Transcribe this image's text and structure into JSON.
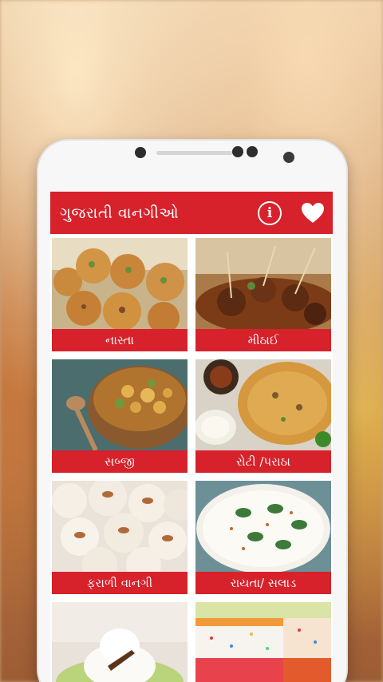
{
  "app": {
    "title": "ગુજરાતી વાનગીઓ",
    "info_icon": "info-icon",
    "favorite_icon": "heart-icon",
    "accent_color": "#d7212b"
  },
  "categories": [
    {
      "label": "નાસ્તા",
      "image": "snack-cookies-photo"
    },
    {
      "label": "મીઠાઈ",
      "image": "sweets-kebab-photo"
    },
    {
      "label": "સબ્જી",
      "image": "vegetable-curry-photo"
    },
    {
      "label": "રોટી /પરાઠા",
      "image": "paratha-photo"
    },
    {
      "label": "ફરાળી વાનગી",
      "image": "coconut-sweets-photo"
    },
    {
      "label": "રાયતા/ સલાડ",
      "image": "raita-bowl-photo"
    },
    {
      "label": "",
      "image": "dessert-cream-photo"
    },
    {
      "label": "",
      "image": "layered-cake-photo"
    }
  ]
}
